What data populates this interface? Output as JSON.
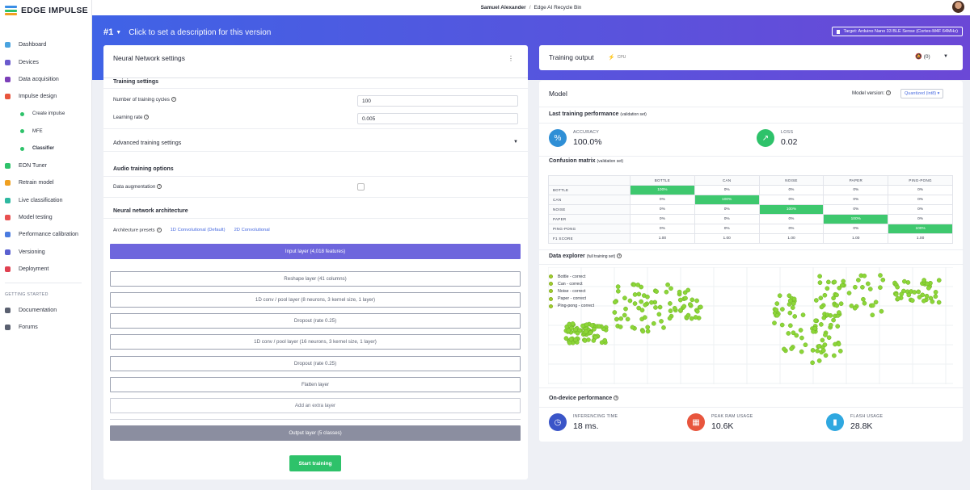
{
  "app": {
    "logo": "EDGE IMPULSE"
  },
  "topbar": {
    "user": "Samuel Alexander",
    "separator": "/",
    "project": "Edge AI Recycle Bin"
  },
  "sidebar": {
    "items": [
      {
        "label": "Dashboard",
        "icon": "monitor-icon",
        "color": "#4aa3df"
      },
      {
        "label": "Devices",
        "icon": "devices-icon",
        "color": "#6a5acd"
      },
      {
        "label": "Data acquisition",
        "icon": "database-icon",
        "color": "#7b3fb8"
      },
      {
        "label": "Impulse design",
        "icon": "impulse-icon",
        "color": "#e8553d"
      }
    ],
    "sub_items": [
      {
        "label": "Create impulse"
      },
      {
        "label": "MFE"
      },
      {
        "label": "Classifier"
      }
    ],
    "items2": [
      {
        "label": "EON Tuner",
        "icon": "tuner-icon",
        "color": "#2ec26a"
      },
      {
        "label": "Retrain model",
        "icon": "retrain-icon",
        "color": "#f0a020"
      },
      {
        "label": "Live classification",
        "icon": "live-icon",
        "color": "#2eb8a0"
      },
      {
        "label": "Model testing",
        "icon": "testing-icon",
        "color": "#e85050"
      },
      {
        "label": "Performance calibration",
        "icon": "calibration-icon",
        "color": "#4a7be0"
      },
      {
        "label": "Versioning",
        "icon": "versioning-icon",
        "color": "#5a60d0"
      },
      {
        "label": "Deployment",
        "icon": "deployment-icon",
        "color": "#e04050"
      }
    ],
    "section_heading": "GETTING STARTED",
    "items3": [
      {
        "label": "Documentation",
        "icon": "book-icon"
      },
      {
        "label": "Forums",
        "icon": "forum-icon"
      }
    ]
  },
  "hero": {
    "version": "#1",
    "description": "Click to set a description for this version",
    "target": "Target: Arduino Nano 33 BLE Sense (Cortex-M4F 64MHz)"
  },
  "nn": {
    "title": "Neural Network settings",
    "training_settings": "Training settings",
    "cycles_label": "Number of training cycles",
    "cycles_value": "100",
    "lr_label": "Learning rate",
    "lr_value": "0.005",
    "advanced": "Advanced training settings",
    "audio": "Audio training options",
    "augmentation": "Data augmentation",
    "architecture": "Neural network architecture",
    "presets_label": "Architecture presets",
    "preset_1": "1D Convolutional (Default)",
    "preset_2": "2D Convolutional",
    "layers": [
      "Input layer (4,018 features)",
      "Reshape layer (41 columns)",
      "1D conv / pool layer (8 neurons, 3 kernel size, 1 layer)",
      "Dropout (rate 0.25)",
      "1D conv / pool layer (16 neurons, 3 kernel size, 1 layer)",
      "Dropout (rate 0.25)",
      "Flatten layer",
      "Add an extra layer",
      "Output layer (5 classes)"
    ],
    "start_button": "Start training"
  },
  "training_output": {
    "title": "Training output",
    "cpu": "CPU",
    "notifications": "(0)"
  },
  "model": {
    "title": "Model",
    "version_label": "Model version:",
    "version_value": "Quantized (int8)",
    "last_perf": "Last training performance",
    "validation_set": "(validation set)",
    "accuracy_label": "ACCURACY",
    "accuracy_value": "100.0%",
    "loss_label": "LOSS",
    "loss_value": "0.02",
    "cm_title": "Confusion matrix",
    "cm_sub": "(validation set)",
    "cm_cols": [
      "BOTTLE",
      "CAN",
      "NOISE",
      "PAPER",
      "PING-PONG"
    ],
    "cm_rows": [
      {
        "label": "BOTTLE",
        "cells": [
          "100%",
          "0%",
          "0%",
          "0%",
          "0%"
        ]
      },
      {
        "label": "CAN",
        "cells": [
          "0%",
          "100%",
          "0%",
          "0%",
          "0%"
        ]
      },
      {
        "label": "NOISE",
        "cells": [
          "0%",
          "0%",
          "100%",
          "0%",
          "0%"
        ]
      },
      {
        "label": "PAPER",
        "cells": [
          "0%",
          "0%",
          "0%",
          "100%",
          "0%"
        ]
      },
      {
        "label": "PING-PONG",
        "cells": [
          "0%",
          "0%",
          "0%",
          "0%",
          "100%"
        ]
      },
      {
        "label": "F1 SCORE",
        "cells": [
          "1.00",
          "1.00",
          "1.00",
          "1.00",
          "1.00"
        ]
      }
    ],
    "explorer_title": "Data explorer",
    "explorer_sub": "(full training set)",
    "legend": [
      "Bottle - correct",
      "Can - correct",
      "Noise - correct",
      "Paper - correct",
      "Ping-pong - correct"
    ],
    "on_device": "On-device performance",
    "inferencing_label": "INFERENCING TIME",
    "inferencing_value": "18 ms.",
    "ram_label": "PEAK RAM USAGE",
    "ram_value": "10.6K",
    "flash_label": "FLASH USAGE",
    "flash_value": "28.8K"
  }
}
